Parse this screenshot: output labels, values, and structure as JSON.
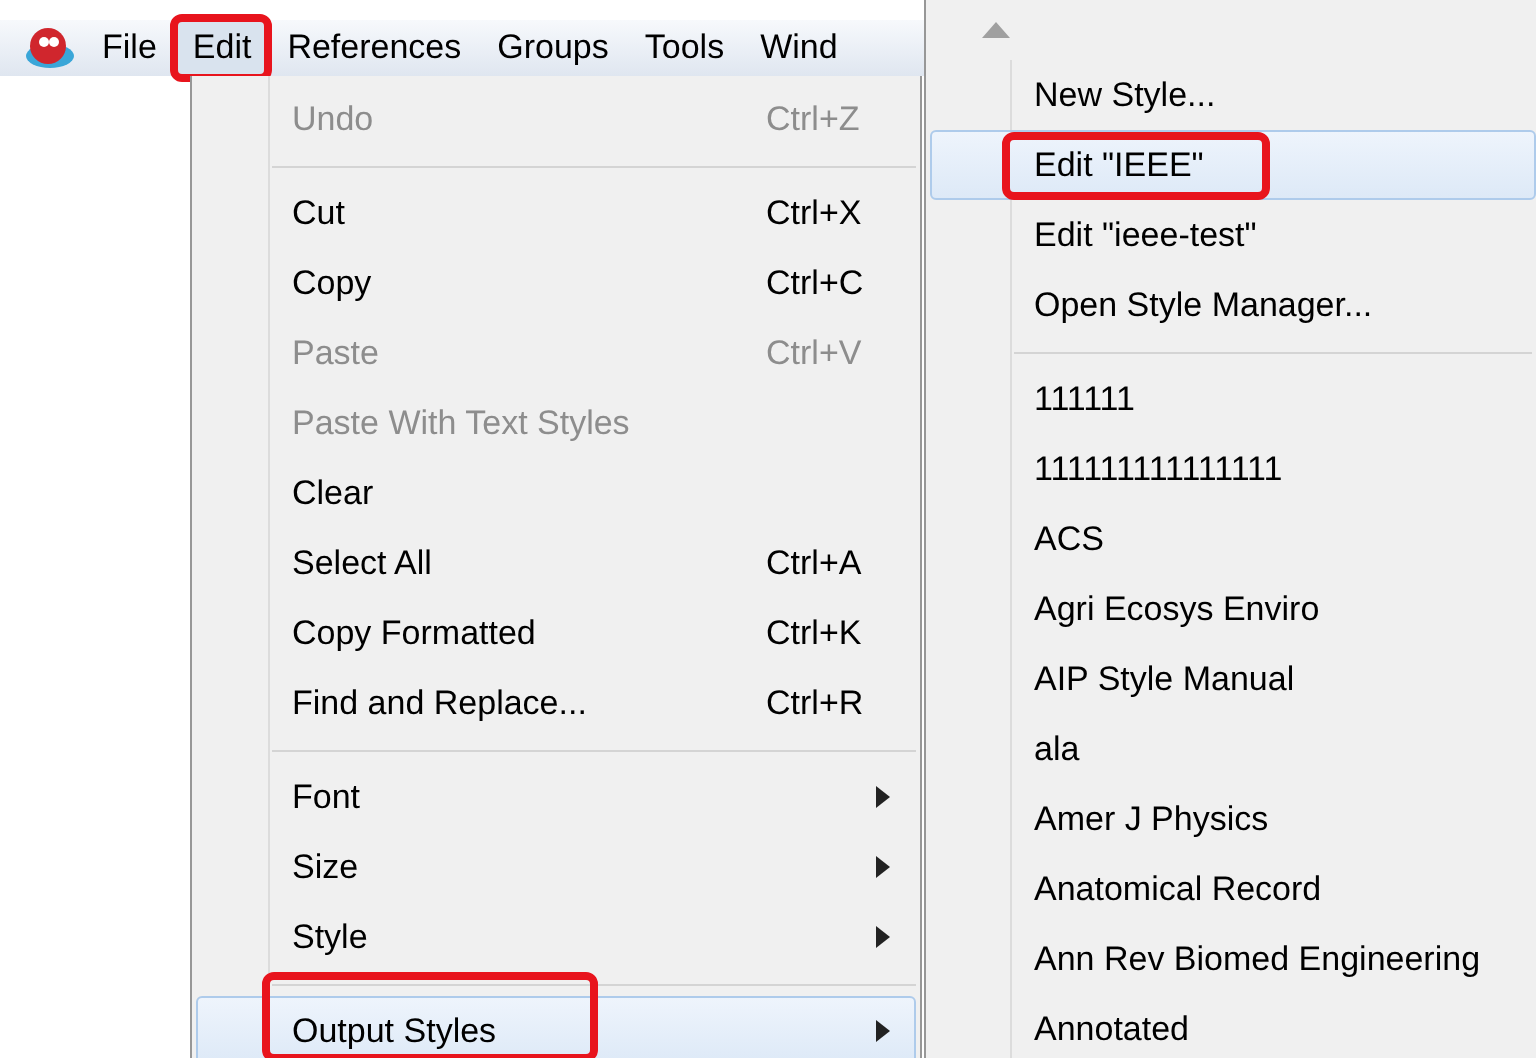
{
  "menubar": {
    "items": [
      {
        "label": "File",
        "selected": false,
        "annotated": false
      },
      {
        "label": "Edit",
        "selected": true,
        "annotated": true
      },
      {
        "label": "References",
        "selected": false,
        "annotated": false
      },
      {
        "label": "Groups",
        "selected": false,
        "annotated": false
      },
      {
        "label": "Tools",
        "selected": false,
        "annotated": false
      },
      {
        "label": "Wind",
        "selected": false,
        "annotated": false
      }
    ]
  },
  "edit_menu": {
    "items": [
      {
        "kind": "item",
        "label": "Undo",
        "shortcut": "Ctrl+Z",
        "disabled": true,
        "selected": false,
        "submenu": false,
        "annotated": false
      },
      {
        "kind": "separator"
      },
      {
        "kind": "item",
        "label": "Cut",
        "shortcut": "Ctrl+X",
        "disabled": false,
        "selected": false,
        "submenu": false,
        "annotated": false
      },
      {
        "kind": "item",
        "label": "Copy",
        "shortcut": "Ctrl+C",
        "disabled": false,
        "selected": false,
        "submenu": false,
        "annotated": false
      },
      {
        "kind": "item",
        "label": "Paste",
        "shortcut": "Ctrl+V",
        "disabled": true,
        "selected": false,
        "submenu": false,
        "annotated": false
      },
      {
        "kind": "item",
        "label": "Paste With Text Styles",
        "disabled": true,
        "selected": false,
        "submenu": false,
        "annotated": false
      },
      {
        "kind": "item",
        "label": "Clear",
        "disabled": false,
        "selected": false,
        "submenu": false,
        "annotated": false
      },
      {
        "kind": "item",
        "label": "Select All",
        "shortcut": "Ctrl+A",
        "disabled": false,
        "selected": false,
        "submenu": false,
        "annotated": false
      },
      {
        "kind": "item",
        "label": "Copy Formatted",
        "shortcut": "Ctrl+K",
        "disabled": false,
        "selected": false,
        "submenu": false,
        "annotated": false
      },
      {
        "kind": "item",
        "label": "Find and Replace...",
        "shortcut": "Ctrl+R",
        "disabled": false,
        "selected": false,
        "submenu": false,
        "annotated": false
      },
      {
        "kind": "separator"
      },
      {
        "kind": "item",
        "label": "Font",
        "disabled": false,
        "selected": false,
        "submenu": true,
        "annotated": false
      },
      {
        "kind": "item",
        "label": "Size",
        "disabled": false,
        "selected": false,
        "submenu": true,
        "annotated": false
      },
      {
        "kind": "item",
        "label": "Style",
        "disabled": false,
        "selected": false,
        "submenu": true,
        "annotated": false
      },
      {
        "kind": "separator"
      },
      {
        "kind": "item",
        "label": "Output Styles",
        "disabled": false,
        "selected": true,
        "submenu": true,
        "annotated": true
      }
    ]
  },
  "output_styles_menu": {
    "items": [
      {
        "kind": "item",
        "label": "New Style...",
        "selected": false,
        "annotated": false
      },
      {
        "kind": "item",
        "label": "Edit \"IEEE\"",
        "selected": true,
        "annotated": true
      },
      {
        "kind": "item",
        "label": "Edit \"ieee-test\"",
        "selected": false,
        "annotated": false
      },
      {
        "kind": "item",
        "label": "Open Style Manager...",
        "selected": false,
        "annotated": false
      },
      {
        "kind": "separator"
      },
      {
        "kind": "item",
        "label": "111111",
        "selected": false,
        "annotated": false
      },
      {
        "kind": "item",
        "label": "111111111111111",
        "selected": false,
        "annotated": false
      },
      {
        "kind": "item",
        "label": "ACS",
        "selected": false,
        "annotated": false
      },
      {
        "kind": "item",
        "label": "Agri Ecosys Enviro",
        "selected": false,
        "annotated": false
      },
      {
        "kind": "item",
        "label": "AIP Style Manual",
        "selected": false,
        "annotated": false
      },
      {
        "kind": "item",
        "label": "ala",
        "selected": false,
        "annotated": false
      },
      {
        "kind": "item",
        "label": "Amer J Physics",
        "selected": false,
        "annotated": false
      },
      {
        "kind": "item",
        "label": "Anatomical Record",
        "selected": false,
        "annotated": false
      },
      {
        "kind": "item",
        "label": "Ann Rev Biomed Engineering",
        "selected": false,
        "annotated": false
      },
      {
        "kind": "item",
        "label": "Annotated",
        "selected": false,
        "annotated": false
      }
    ]
  }
}
